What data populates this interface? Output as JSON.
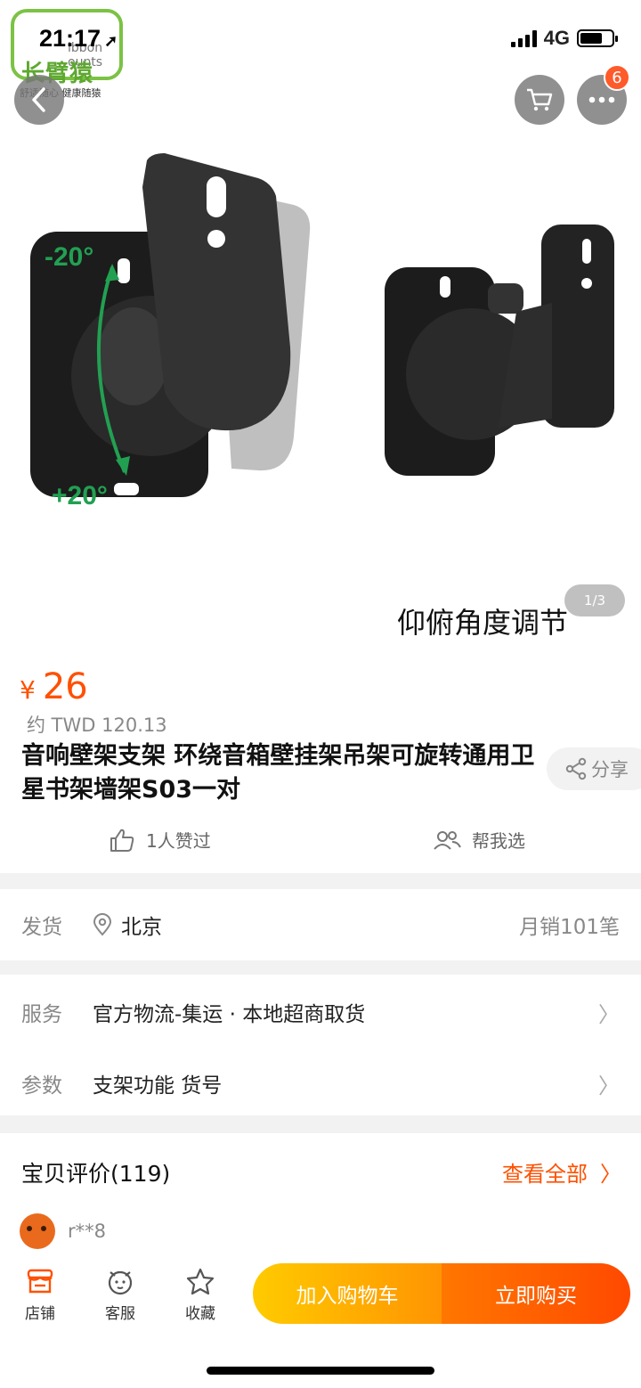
{
  "status": {
    "time": "21:17",
    "network": "4G"
  },
  "logo": {
    "brand_cn": "长臂猿",
    "brand_en": "ibbon ounts",
    "slogan": "舒适随心 健康随猿"
  },
  "header": {
    "cart_badge": "6"
  },
  "gallery": {
    "caption": "仰俯角度调节",
    "pager": "1/3",
    "angle_top": "-20°",
    "angle_bottom": "+20°"
  },
  "product": {
    "currency": "¥",
    "price": "26",
    "twd_price": "约 TWD 120.13",
    "title": "音响壁架支架 环绕音箱壁挂架吊架可旋转通用卫星书架墙架S03一对",
    "share_label": "分享",
    "likes_label": "1人赞过",
    "help_label": "帮我选"
  },
  "shipping": {
    "label": "发货",
    "location": "北京",
    "monthly_sales": "月销101笔"
  },
  "service": {
    "label": "服务",
    "value": "官方物流-集运 · 本地超商取货"
  },
  "params": {
    "label": "参数",
    "value": "支架功能 货号"
  },
  "reviews": {
    "title": "宝贝评价(119)",
    "view_all": "查看全部",
    "first_reviewer": "r**8"
  },
  "bottom_nav": {
    "store": "店铺",
    "service": "客服",
    "favorite": "收藏",
    "add_to_cart": "加入购物车",
    "buy_now": "立即购买"
  }
}
